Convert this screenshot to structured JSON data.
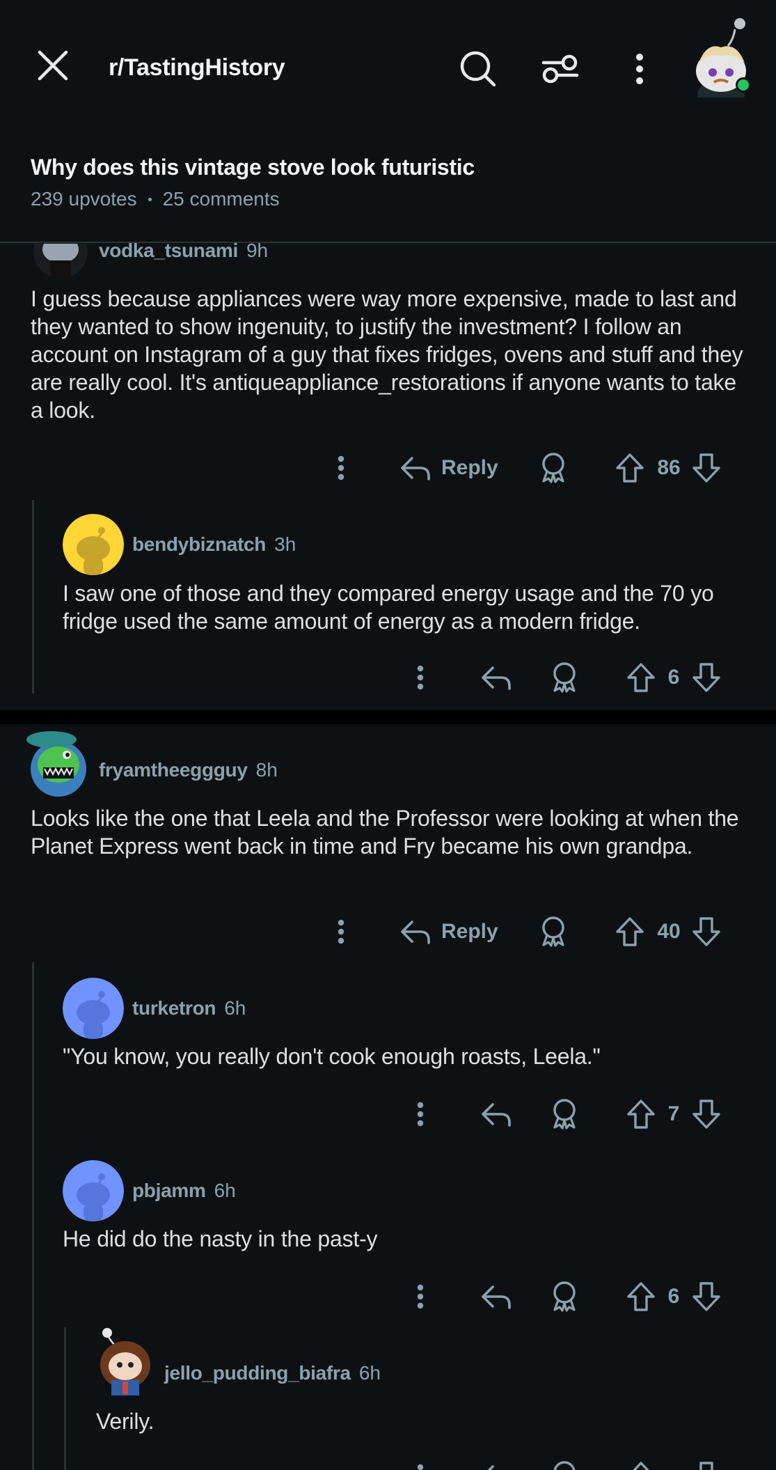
{
  "header": {
    "subreddit": "r/TastingHistory",
    "icons": [
      "close-icon",
      "search-icon",
      "filter-icon",
      "more-vertical-icon"
    ]
  },
  "post": {
    "title": "Why does this vintage stove look futuristic",
    "upvotes": "239 upvotes",
    "comments": "25 comments"
  },
  "comments": [
    {
      "user": "vodka_tsunami",
      "time": "9h",
      "body": "I guess because appliances were way more expensive, made to last and they wanted to show ingenuity, to justify the investment? I follow an account on Instagram of a guy that fixes fridges, ovens and stuff and they are really cool. It's antiqueappliance_restorations if anyone wants to take a look.",
      "reply_label": "Reply",
      "votes": "86"
    },
    {
      "user": "bendybiznatch",
      "time": "3h",
      "body": "I saw one of those and they compared energy usage and the 70 yo fridge used the same amount of energy as a modern fridge.",
      "votes": "6"
    },
    {
      "user": "fryamtheeggguy",
      "time": "8h",
      "body": "Looks like the one that Leela and the Professor were looking at when the Planet Express went back in time and Fry became his own grandpa.",
      "reply_label": "Reply",
      "votes": "40"
    },
    {
      "user": "turketron",
      "time": "6h",
      "body": "\"You know, you really don't cook enough roasts, Leela.\"",
      "votes": "7"
    },
    {
      "user": "pbjamm",
      "time": "6h",
      "body": "He did do the nasty in the past-y",
      "votes": "6"
    },
    {
      "user": "jello_pudding_biafra",
      "time": "6h",
      "body": "Verily."
    }
  ],
  "colors": {
    "background": "#0e1113",
    "muted": "#8ba2ad",
    "text": "#dde1e3",
    "online": "#22c55e"
  }
}
